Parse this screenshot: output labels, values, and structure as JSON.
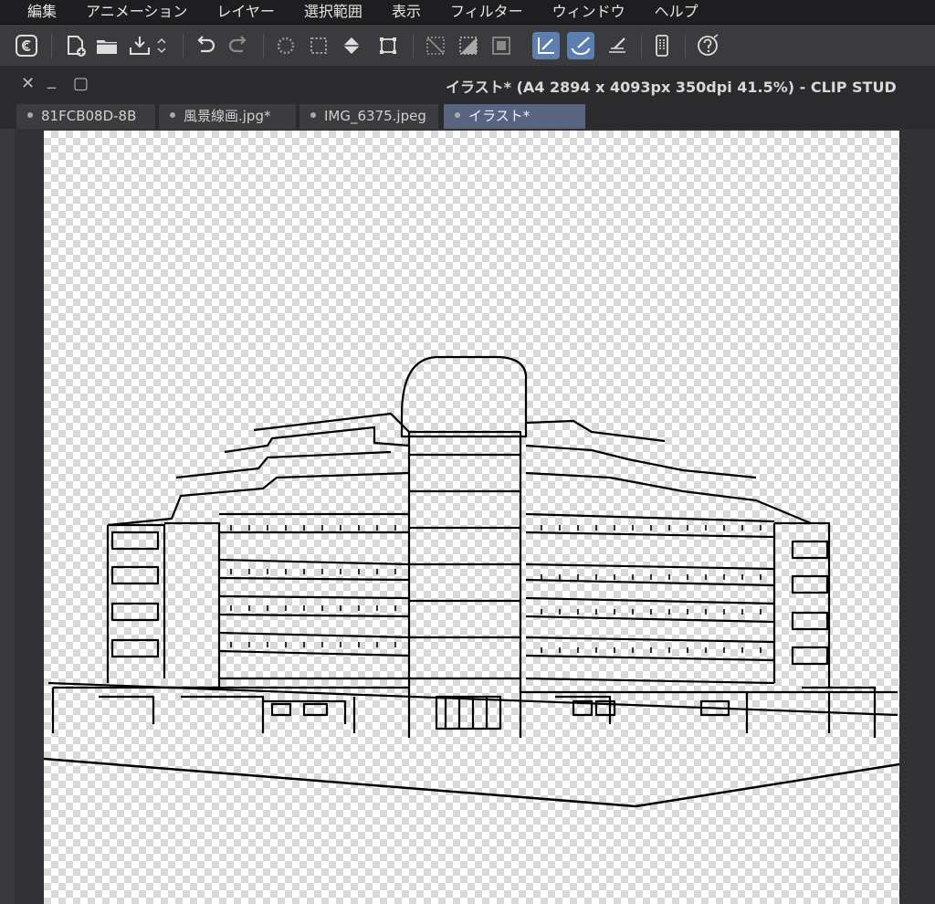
{
  "menu": [
    "編集",
    "アニメーション",
    "レイヤー",
    "選択範囲",
    "表示",
    "フィルター",
    "ウィンドウ",
    "ヘルプ"
  ],
  "window": {
    "title": "イラスト* (A4 2894 x 4093px 350dpi 41.5%)  - CLIP STUD",
    "close_glyph": "✕",
    "minimize_glyph": "_",
    "maximize_glyph": "▢"
  },
  "tabs": [
    {
      "label": "81FCB08D-8B",
      "active": false
    },
    {
      "label": "風景線画.jpg*",
      "active": false
    },
    {
      "label": "IMG_6375.jpeg",
      "active": false
    },
    {
      "label": "イラスト*",
      "active": true
    }
  ],
  "toolbar": {
    "icons": [
      "clip-studio-icon",
      "new-canvas-icon",
      "open-folder-icon",
      "save-icon",
      "dropdown-icon",
      "undo-icon",
      "redo-icon",
      "deselect-icon",
      "select-all-icon",
      "fill-icon",
      "transform-icon",
      "clear-selection-icon",
      "fill-selection-icon",
      "invert-selection-icon",
      "snap-ruler-icon",
      "snap-special-ruler-icon",
      "snap-grid-icon",
      "smartphone-icon",
      "help-icon"
    ],
    "active": [
      "snap-ruler-icon",
      "snap-special-ruler-icon"
    ]
  },
  "colors": {
    "accent": "#5a7fb0",
    "active_tab": "#596580",
    "menubar": "#1e1e20"
  }
}
